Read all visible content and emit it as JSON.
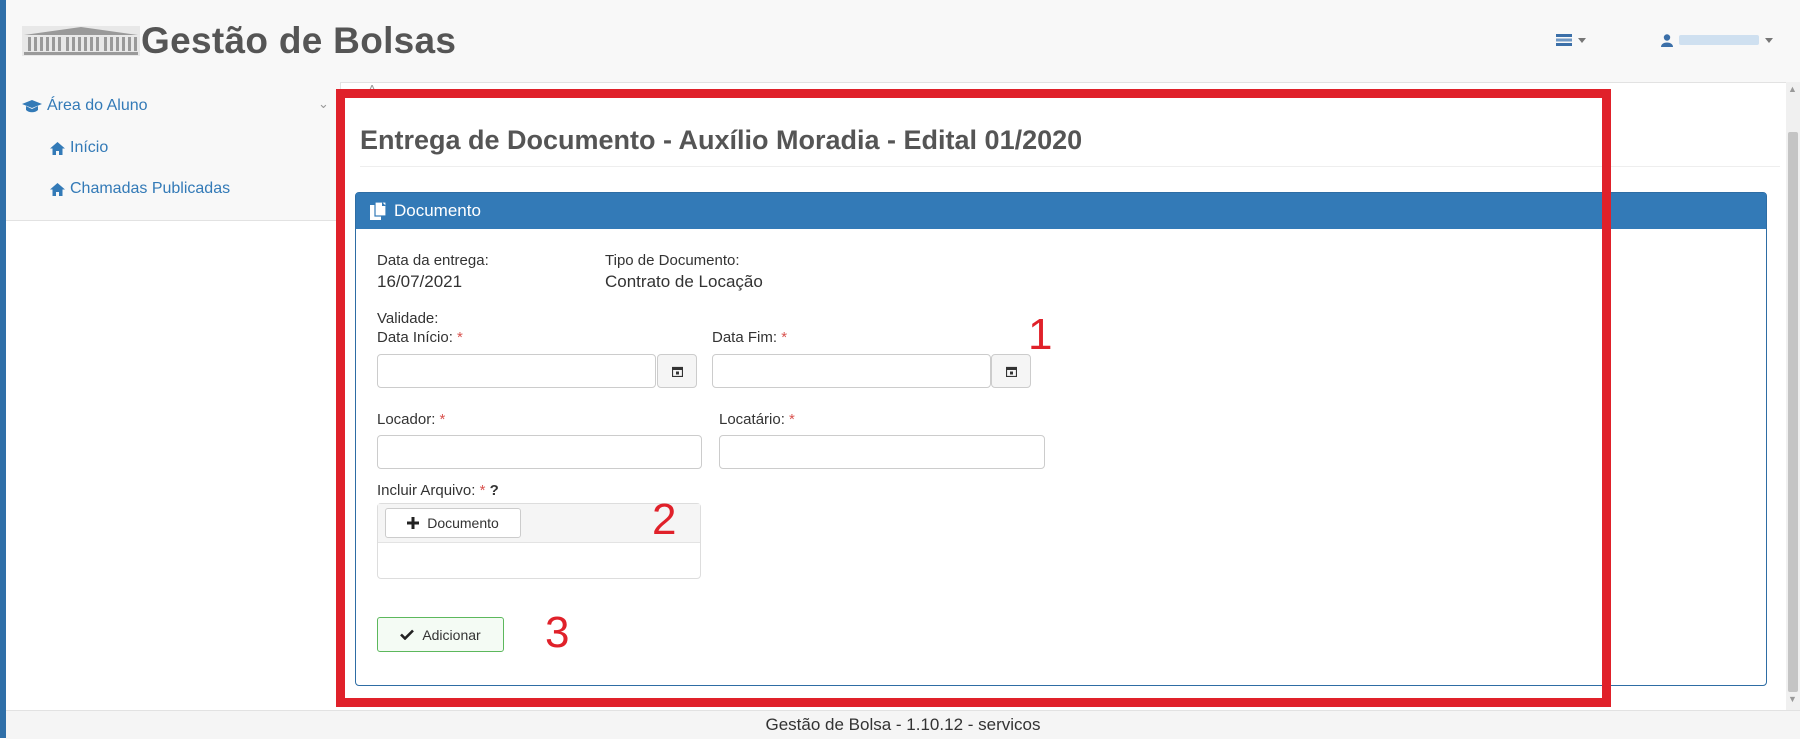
{
  "header": {
    "app_title": "Gestão de Bolsas",
    "logo_icon": "building-columns-icon",
    "menu_icon": "list-menu-icon",
    "user_icon": "user-icon"
  },
  "sidebar": {
    "section": {
      "label": "Área do Aluno",
      "icon": "graduation-cap-icon"
    },
    "items": [
      {
        "label": "Início",
        "icon": "home-icon"
      },
      {
        "label": "Chamadas Publicadas",
        "icon": "home-icon"
      }
    ]
  },
  "main": {
    "title": "Entrega de Documento - Auxílio Moradia - Edital 01/2020",
    "panel": {
      "heading": "Documento",
      "delivery_date_label": "Data da entrega:",
      "delivery_date_value": "16/07/2021",
      "doc_type_label": "Tipo de Documento:",
      "doc_type_value": "Contrato de Locação",
      "validity_label": "Validade:",
      "start_date_label": "Data Início:",
      "end_date_label": "Data Fim:",
      "landlord_label": "Locador:",
      "tenant_label": "Locatário:",
      "attach_label": "Incluir Arquivo:",
      "required_mark": "*",
      "help_mark": "?",
      "document_button": "Documento",
      "add_button": "Adicionar",
      "start_date_value": "",
      "end_date_value": "",
      "landlord_value": "",
      "tenant_value": ""
    }
  },
  "annotations": {
    "one": "1",
    "two": "2",
    "three": "3",
    "color": "#e0212a"
  },
  "footer": {
    "text": "Gestão de Bolsa - 1.10.12 - servicos"
  },
  "colors": {
    "primary": "#337ab7",
    "success": "#5cb85c",
    "required": "#d9534f"
  }
}
